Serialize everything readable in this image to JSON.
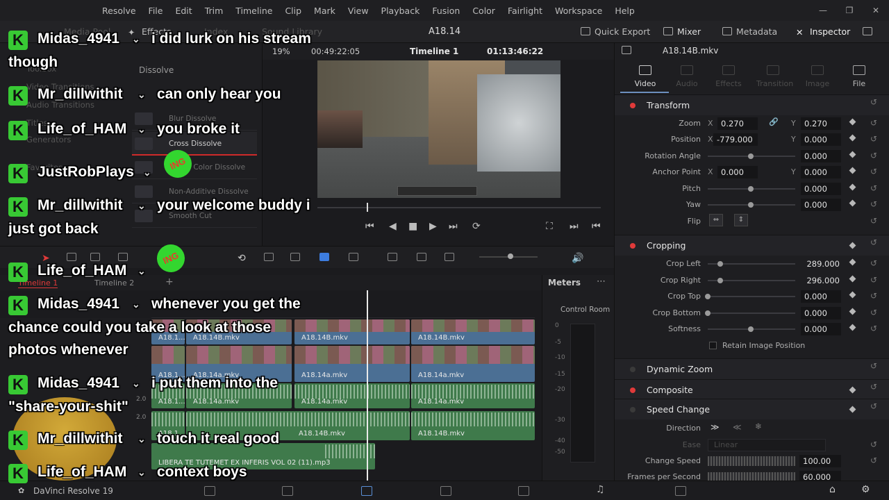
{
  "app": {
    "menu": [
      "Resolve",
      "File",
      "Edit",
      "Trim",
      "Timeline",
      "Clip",
      "Mark",
      "View",
      "Playback",
      "Fusion",
      "Color",
      "Fairlight",
      "Workspace",
      "Help"
    ],
    "version_label": "DaVinci Resolve 19",
    "project_title": "A18.14"
  },
  "toolbar": {
    "media_pool": "Media Pool",
    "effects": "Effects",
    "index": "Index",
    "sound_library": "Sound Library",
    "quick_export": "Quick Export",
    "mixer": "Mixer",
    "metadata": "Metadata",
    "inspector": "Inspector"
  },
  "effects_panel": {
    "toolbox": "Toolbox",
    "video_transitions": "Video Transitions",
    "audio_transitions": "Audio Transitions",
    "titles": "Titles",
    "generators": "Generators",
    "favorites": "Favorites",
    "category": "Dissolve",
    "items": [
      "Blur Dissolve",
      "Cross Dissolve",
      "Dip To Color Dissolve",
      "Non-Additive Dissolve",
      "Smooth Cut"
    ],
    "selected_index": 1
  },
  "viewer": {
    "zoom": "19%",
    "source_timecode": "00:49:22:05",
    "timeline_name": "Timeline 1",
    "record_timecode": "01:13:46:22"
  },
  "timeline": {
    "tabs": [
      "Timeline 1",
      "Timeline 2"
    ],
    "clips": {
      "v2_a": "A18.1...",
      "v2_b": "A18.14B.mkv",
      "v2_c": "A18.14B.mkv",
      "v2_d": "A18.14B.mkv",
      "v1_a": "A18.1...",
      "v1_b": "A18.14a.mkv",
      "v1_c": "A18.14a.mkv",
      "v1_d": "A18.14a.mkv",
      "a1_a": "A18.1...",
      "a1_b": "A18.14a.mkv",
      "a1_c": "A18.14a.mkv",
      "a1_d": "A18.14a.mkv",
      "a2_a": "A18.1...",
      "a2_b": "A18.14B.mkv",
      "a2_c": "A18.14B.mkv",
      "mp3": "LIBERA TE TUTEMET EX INFERIS VOL 02 (11).mp3"
    },
    "track_values": [
      "2.0",
      "2.0"
    ]
  },
  "meters": {
    "title": "Meters",
    "room": "Control Room",
    "scale": [
      "0",
      "-5",
      "-10",
      "-15",
      "-20",
      "-30",
      "-40",
      "-50"
    ]
  },
  "inspector": {
    "file": "A18.14B.mkv",
    "tabs": [
      "Video",
      "Audio",
      "Effects",
      "Transition",
      "Image",
      "File"
    ],
    "active_tab": "Video",
    "transform": {
      "title": "Transform",
      "zoom_label": "Zoom",
      "zoom_x": "0.270",
      "zoom_y": "0.270",
      "position_label": "Position",
      "position_x": "-779.000",
      "position_y": "0.000",
      "rotation_label": "Rotation Angle",
      "rotation": "0.000",
      "anchor_label": "Anchor Point",
      "anchor_x": "0.000",
      "anchor_y": "0.000",
      "pitch_label": "Pitch",
      "pitch": "0.000",
      "yaw_label": "Yaw",
      "yaw": "0.000",
      "flip_label": "Flip"
    },
    "cropping": {
      "title": "Cropping",
      "left_label": "Crop Left",
      "left": "289.000",
      "right_label": "Crop Right",
      "right": "296.000",
      "top_label": "Crop Top",
      "top": "0.000",
      "bottom_label": "Crop Bottom",
      "bottom": "0.000",
      "softness_label": "Softness",
      "softness": "0.000",
      "retain_label": "Retain Image Position"
    },
    "dynamic_zoom": "Dynamic Zoom",
    "composite": "Composite",
    "speed_change": {
      "title": "Speed Change",
      "direction_label": "Direction",
      "ease_label": "Ease",
      "ease_value": "Linear",
      "speed_label": "Change Speed",
      "speed": "100.00",
      "fps_label": "Frames per Second",
      "fps": "60.000"
    },
    "axis_x": "X",
    "axis_y": "Y"
  },
  "chat": [
    {
      "user": "Midas_4941",
      "text": "i did lurk on his stream",
      "cont": "though"
    },
    {
      "user": "Mr_dillwithit",
      "text": "can only hear you"
    },
    {
      "user": "Life_of_HAM",
      "text": "you broke it"
    },
    {
      "user": "JustRobPlays",
      "text": ""
    },
    {
      "user": "Mr_dillwithit",
      "text": "your welcome buddy i",
      "cont": "just got back"
    },
    {
      "user": "Life_of_HAM",
      "text": ""
    },
    {
      "user": "Midas_4941",
      "text": "whenever you get the",
      "cont": "chance could you take a look at those",
      "cont2": "photos whenever"
    },
    {
      "user": "Midas_4941",
      "text": "i put them into the",
      "cont": "\"share-your-shit\""
    },
    {
      "user": "Mr_dillwithit",
      "text": "touch it real good"
    },
    {
      "user": "Life_of_HAM",
      "text": "context boys"
    }
  ],
  "chat_ui": {
    "k_glyph": "K",
    "chevron": "⌄",
    "badge": "ING"
  },
  "icons": [
    "media-pool-icon",
    "effects-icon",
    "index-icon",
    "sound-library-icon",
    "quick-export-icon",
    "mixer-icon",
    "metadata-icon",
    "inspector-icon",
    "keyframe-icon",
    "reset-icon",
    "play-icon",
    "stop-icon",
    "loop-icon",
    "volume-icon"
  ],
  "colors": {
    "accent_red": "#e03a3a",
    "clip_video": "#4b6f94",
    "clip_audio": "#3f7a4b",
    "chat_green": "#38c934"
  }
}
